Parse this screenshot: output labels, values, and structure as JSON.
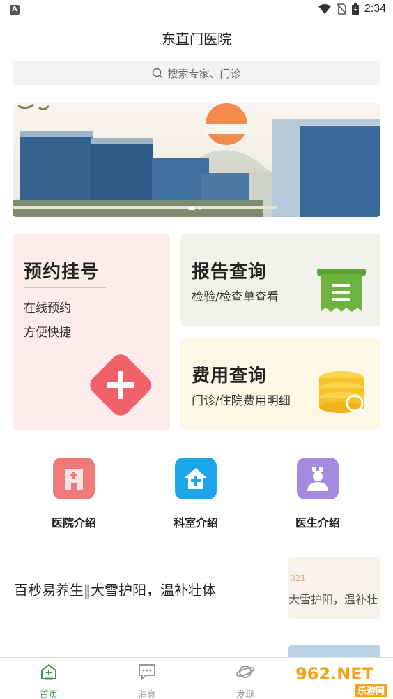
{
  "status_bar": {
    "time": "2:34",
    "left_badge": "A"
  },
  "header": {
    "title": "东直门医院"
  },
  "search": {
    "placeholder": "搜索专家、门诊"
  },
  "cards": {
    "appointment": {
      "title": "预约挂号",
      "line1": "在线预约",
      "line2": "方便快捷",
      "accent": "#f2606a"
    },
    "report": {
      "title": "报告查询",
      "subtitle": "检验/检查单查看",
      "accent": "#6db33f"
    },
    "fee": {
      "title": "费用查询",
      "subtitle": "门诊/住院费用明细",
      "accent": "#f5c22b"
    }
  },
  "quick_links": [
    {
      "label": "医院介绍",
      "icon": "hospital-icon",
      "color": "#f07a7a"
    },
    {
      "label": "科室介绍",
      "icon": "department-icon",
      "color": "#1aa6e8"
    },
    {
      "label": "医生介绍",
      "icon": "doctor-icon",
      "color": "#a58be0"
    }
  ],
  "news": {
    "title": "百秒易养生‖大雪护阳，温补壮体",
    "thumb_text": "大雪护阳，温补壮",
    "thumb_number": "021"
  },
  "bottom_nav": [
    {
      "label": "首页",
      "icon": "home-icon",
      "active": true
    },
    {
      "label": "消息",
      "icon": "message-icon",
      "active": false
    },
    {
      "label": "发现",
      "icon": "planet-icon",
      "active": false
    }
  ],
  "watermark": {
    "brand": "962.NET",
    "sub": "乐游网"
  }
}
